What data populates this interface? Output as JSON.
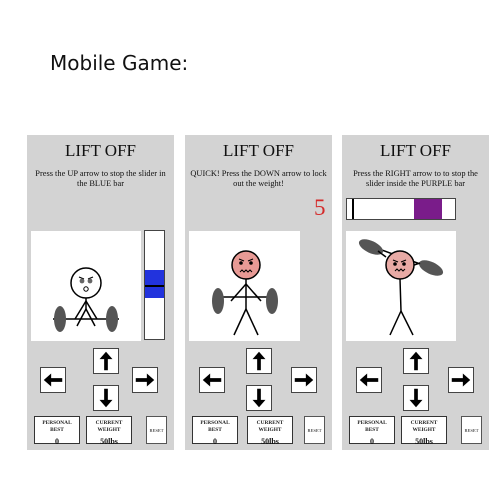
{
  "caption": "Mobile Game:",
  "screens": [
    {
      "title": "LIFT OFF",
      "instruction": "Press the UP arrow to stop the slider in the BLUE bar",
      "stats": {
        "best_label": "PERSONAL BEST",
        "best_value": "0",
        "weight_label": "CURRENT WEIGHT",
        "weight_value": "50lbs"
      },
      "reset_label": "RESET",
      "target_color": "#2233dd"
    },
    {
      "title": "LIFT OFF",
      "instruction": "QUICK! Press the DOWN arrow to lock out the weight!",
      "countdown": "5",
      "stats": {
        "best_label": "PERSONAL BEST",
        "best_value": "0",
        "weight_label": "CURRENT WEIGHT",
        "weight_value": "50lbs"
      },
      "reset_label": "RESET"
    },
    {
      "title": "LIFT OFF",
      "instruction": "Press the RIGHT arrow to to stop the slider inside the PURPLE bar",
      "stats": {
        "best_label": "PERSONAL BEST",
        "best_value": "0",
        "weight_label": "CURRENT WEIGHT",
        "weight_value": "50lbs"
      },
      "reset_label": "RESET",
      "target_color": "#7a1c8a"
    }
  ],
  "icons": [
    "up-arrow-icon",
    "down-arrow-icon",
    "left-arrow-icon",
    "right-arrow-icon"
  ]
}
